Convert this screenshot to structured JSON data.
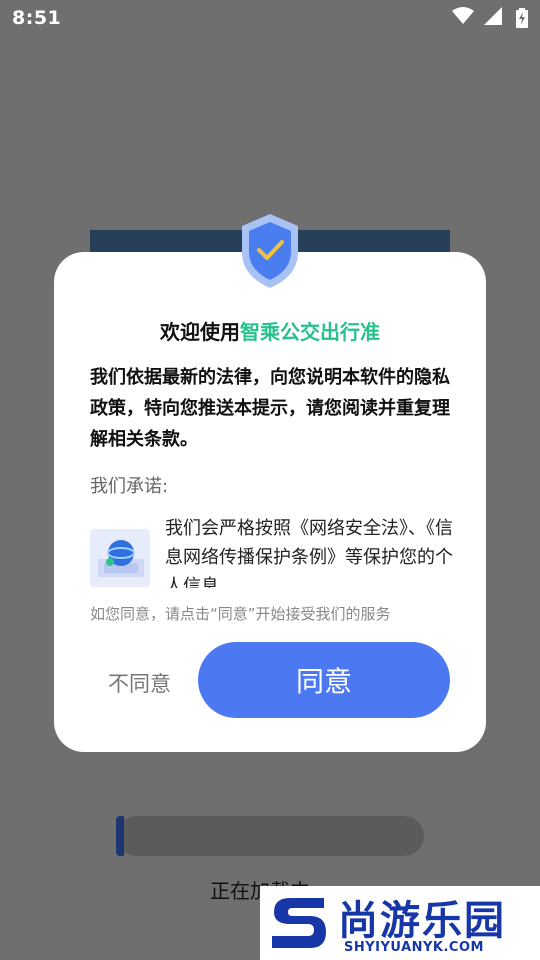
{
  "status_bar": {
    "time": "8:51",
    "icons": [
      "wifi-icon",
      "cell-signal-icon",
      "battery-charging-icon"
    ]
  },
  "loading": {
    "text": "正在加载中",
    "progress": 0.02
  },
  "dialog": {
    "title_prefix": "欢迎使用",
    "title_app": "智乘公交出行准",
    "lead": "我们依据最新的法律，向您说明本软件的隐私政策，特向您推送本提示，请您阅读并重复理解相关条款。",
    "promise_label": "我们承诺:",
    "clause": "我们会严格按照《网络安全法》、《信息网络传播保护条例》等保护您的个人信息",
    "hint": "如您同意，请点击“同意”开始接受我们的服务",
    "disagree_label": "不同意",
    "agree_label": "同意"
  },
  "watermark": {
    "name": "尚游乐园",
    "url": "SHYIYUANYK.COM"
  },
  "colors": {
    "accent": "#4c78f2",
    "app_name": "#27c18c",
    "overlay": "#6f6f6f"
  }
}
